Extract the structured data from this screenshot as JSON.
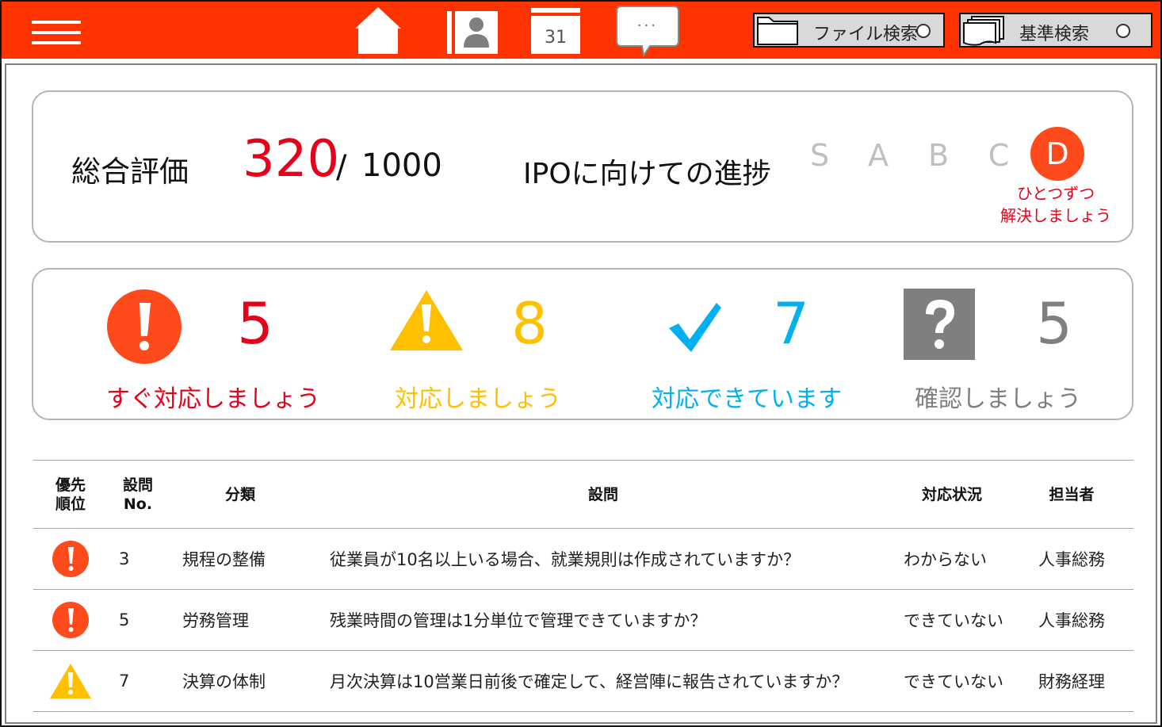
{
  "header": {
    "menu_icon": "hamburger-menu-icon",
    "nav_icons": [
      "home-icon",
      "contact-book-icon",
      "calendar-icon",
      "chat-icon"
    ],
    "calendar_day": "31",
    "chat_text": "···",
    "file_search_label": "ファイル検索",
    "standard_search_label": "基準検索",
    "accent_color": "#ff3300"
  },
  "score": {
    "label": "総合評価",
    "value": "320",
    "separator": "/",
    "max": "1000",
    "progress_label": "IPOに向けての進捗",
    "grades": [
      "S",
      "A",
      "B",
      "C",
      "D"
    ],
    "current_grade": "D",
    "message_line1": "ひとつずつ",
    "message_line2": "解決しましょう"
  },
  "summary": [
    {
      "icon": "urgent-alert-icon",
      "count": "5",
      "caption": "すぐ対応しましょう",
      "color": "#e6001a"
    },
    {
      "icon": "warning-triangle-icon",
      "count": "8",
      "caption": "対応しましょう",
      "color": "#ffc000"
    },
    {
      "icon": "checkmark-icon",
      "count": "7",
      "caption": "対応できています",
      "color": "#00b0f0"
    },
    {
      "icon": "question-mark-icon",
      "count": "5",
      "caption": "確認しましょう",
      "color": "#7f7f7f"
    }
  ],
  "table": {
    "headers": {
      "priority_l1": "優先",
      "priority_l2": "順位",
      "no_l1": "設問",
      "no_l2": "No.",
      "category": "分類",
      "question": "設問",
      "status": "対応状況",
      "owner": "担当者"
    },
    "rows": [
      {
        "priority_icon": "urgent-alert-icon",
        "no": "3",
        "category": "規程の整備",
        "question": "従業員が10名以上いる場合、就業規則は作成されていますか？",
        "status": "わからない",
        "owner": "人事総務"
      },
      {
        "priority_icon": "urgent-alert-icon",
        "no": "5",
        "category": "労務管理",
        "question": "残業時間の管理は1分単位で管理できていますか？",
        "status": "できていない",
        "owner": "人事総務"
      },
      {
        "priority_icon": "warning-triangle-icon",
        "no": "7",
        "category": "決算の体制",
        "question": "月次決算は10営業日前後で確定して、経営陣に報告されていますか？",
        "status": "できていない",
        "owner": "財務経理"
      }
    ]
  }
}
